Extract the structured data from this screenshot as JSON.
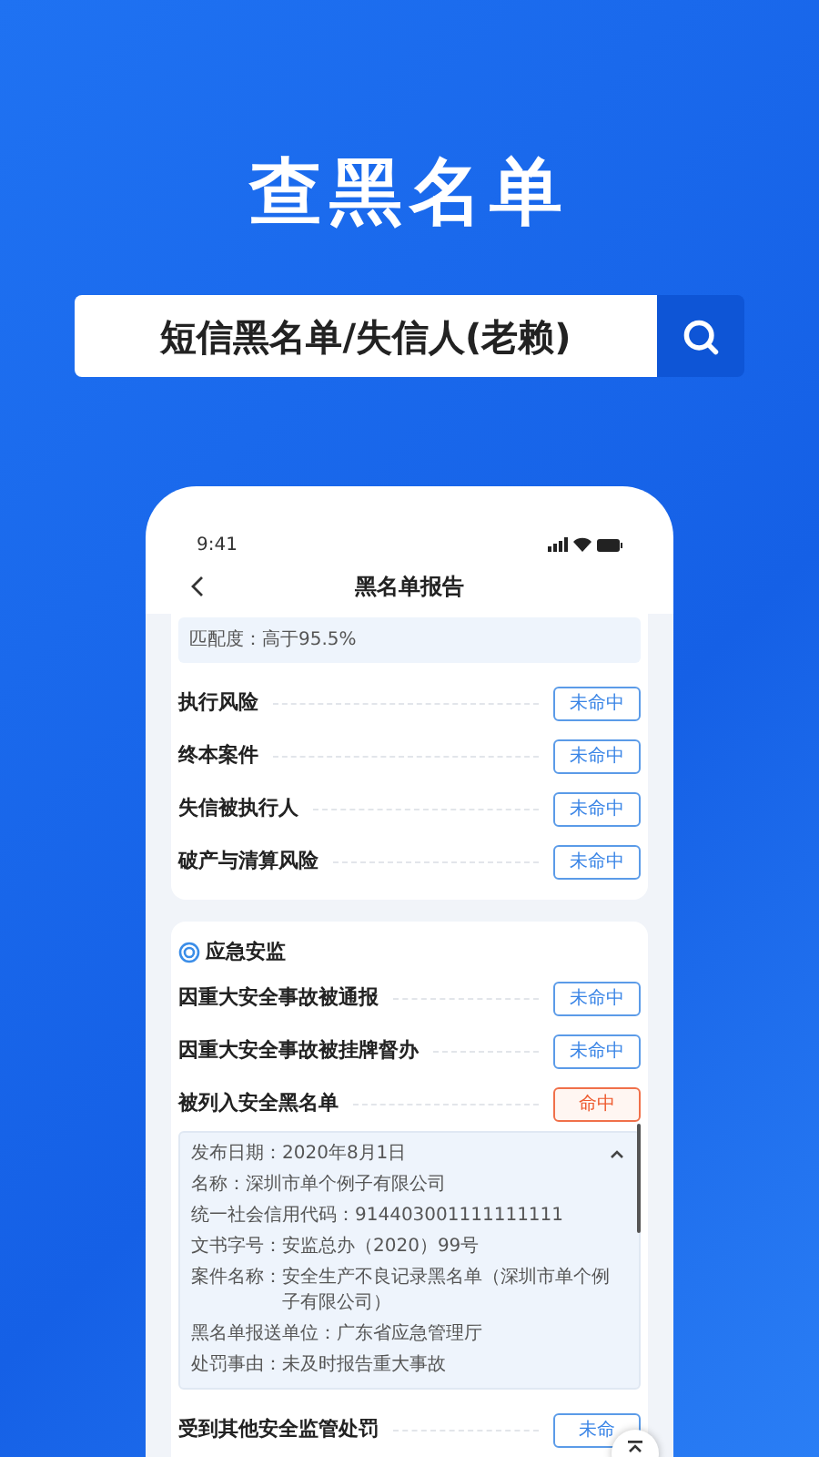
{
  "headline": "查黑名单",
  "search": {
    "value": "短信黑名单/失信人(老赖)"
  },
  "phone": {
    "status_time": "9:41",
    "title": "黑名单报告",
    "match": "匹配度：高于95.5%",
    "risk_items": [
      {
        "label": "执行风险",
        "result": "未命中",
        "hit": false
      },
      {
        "label": "终本案件",
        "result": "未命中",
        "hit": false
      },
      {
        "label": "失信被执行人",
        "result": "未命中",
        "hit": false
      },
      {
        "label": "破产与清算风险",
        "result": "未命中",
        "hit": false
      }
    ],
    "section": {
      "title": "应急安监",
      "items": [
        {
          "label": "因重大安全事故被通报",
          "result": "未命中",
          "hit": false
        },
        {
          "label": "因重大安全事故被挂牌督办",
          "result": "未命中",
          "hit": false
        },
        {
          "label": "被列入安全黑名单",
          "result": "命中",
          "hit": true,
          "expanded": true,
          "details": [
            {
              "label": "发布日期：",
              "value": "2020年8月1日"
            },
            {
              "label": "名称：",
              "value": "深圳市单个例子有限公司"
            },
            {
              "label": "统一社会信用代码：",
              "value": "914403001111111111"
            },
            {
              "label": "文书字号：",
              "value": "安监总办（2020）99号"
            },
            {
              "label": "案件名称：",
              "value": "安全生产不良记录黑名单（深圳市单个例子有限公司）"
            },
            {
              "label": "黑名单报送单位：",
              "value": "广东省应急管理厅"
            },
            {
              "label": "处罚事由：",
              "value": "未及时报告重大事故"
            }
          ]
        },
        {
          "label": "受到其他安全监管处罚",
          "result": "未命",
          "hit": false
        }
      ]
    }
  }
}
